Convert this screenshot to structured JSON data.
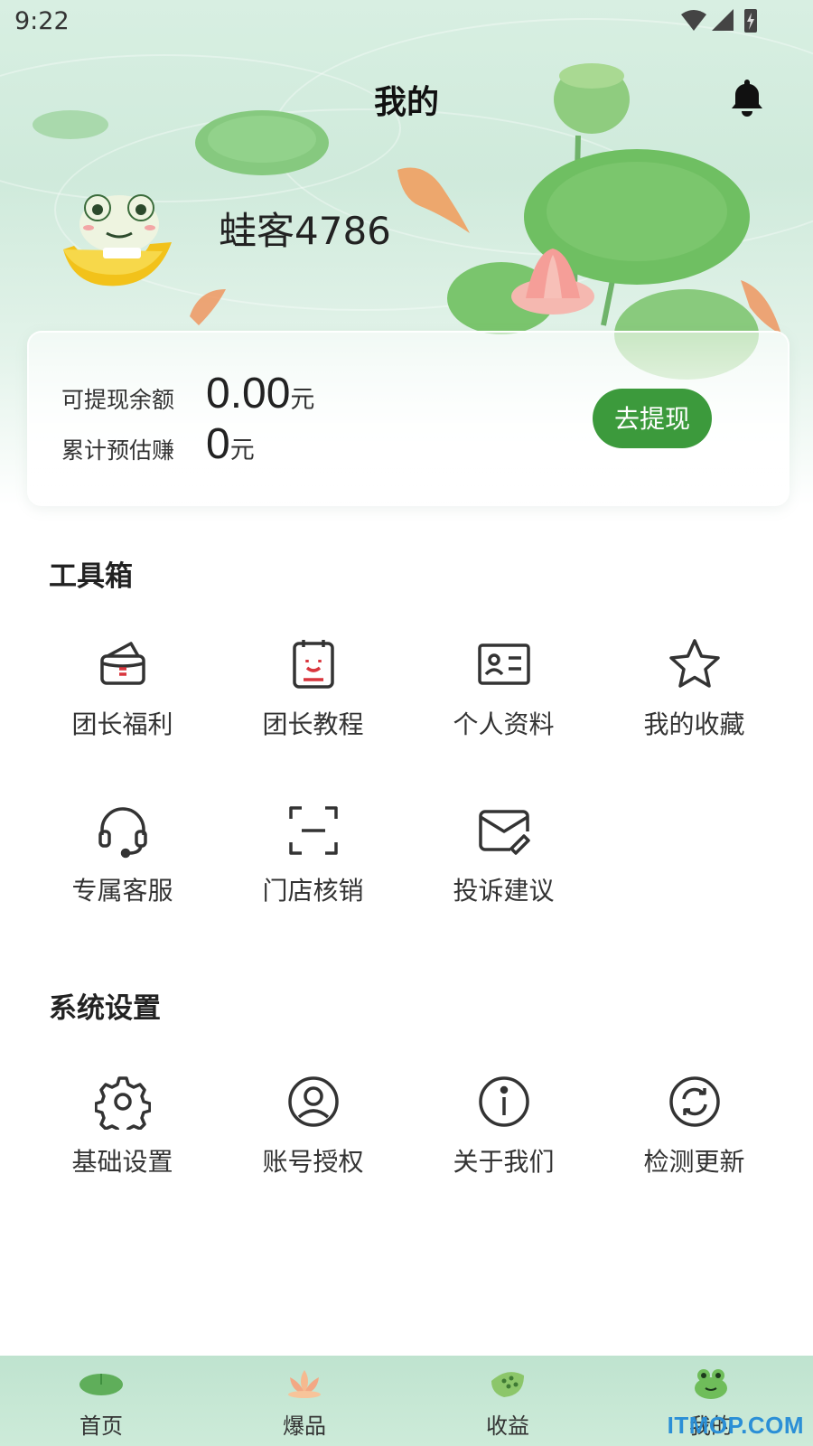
{
  "status_bar": {
    "time": "9:22"
  },
  "header": {
    "title": "我的",
    "username": "蛙客4786"
  },
  "balance": {
    "withdrawable_label": "可提现余额",
    "withdrawable_value": "0.00",
    "withdrawable_unit": "元",
    "estimated_label": "累计预估赚",
    "estimated_value": "0",
    "estimated_unit": "元",
    "withdraw_button": "去提现",
    "accent_color": "#3c9a3c"
  },
  "toolbox": {
    "title": "工具箱",
    "items": [
      {
        "label": "团长福利",
        "icon": "wallet-icon"
      },
      {
        "label": "团长教程",
        "icon": "notebook-icon"
      },
      {
        "label": "个人资料",
        "icon": "id-card-icon"
      },
      {
        "label": "我的收藏",
        "icon": "star-icon"
      },
      {
        "label": "专属客服",
        "icon": "headset-icon"
      },
      {
        "label": "门店核销",
        "icon": "scan-icon"
      },
      {
        "label": "投诉建议",
        "icon": "feedback-mail-icon"
      }
    ]
  },
  "settings": {
    "title": "系统设置",
    "items": [
      {
        "label": "基础设置",
        "icon": "gear-icon"
      },
      {
        "label": "账号授权",
        "icon": "user-circle-icon"
      },
      {
        "label": "关于我们",
        "icon": "info-icon"
      },
      {
        "label": "检测更新",
        "icon": "refresh-icon"
      }
    ]
  },
  "tabbar": {
    "items": [
      {
        "label": "首页",
        "icon": "lotus-leaf-icon"
      },
      {
        "label": "爆品",
        "icon": "lotus-flower-icon"
      },
      {
        "label": "收益",
        "icon": "lotus-pod-icon"
      },
      {
        "label": "我的",
        "icon": "frog-icon"
      }
    ]
  },
  "watermark": "ITMOP.COM"
}
